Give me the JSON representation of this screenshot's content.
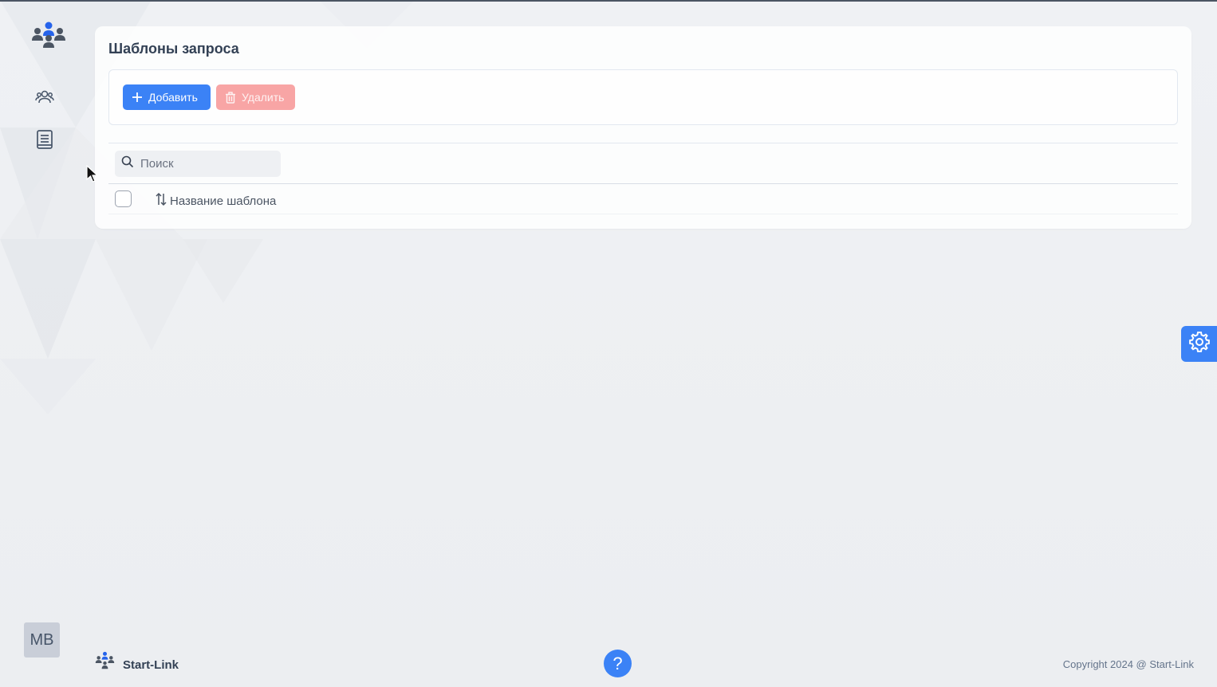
{
  "sidebar": {
    "logo_icon": "team-logo-icon",
    "items": [
      {
        "icon": "users-icon"
      },
      {
        "icon": "document-icon"
      }
    ],
    "avatar_initials": "MB"
  },
  "page": {
    "title": "Шаблоны запроса"
  },
  "toolbar": {
    "add_label": "Добавить",
    "add_icon": "plus-icon",
    "delete_label": "Удалить",
    "delete_icon": "trash-icon"
  },
  "search": {
    "placeholder": "Поиск",
    "value": ""
  },
  "table": {
    "columns": [
      {
        "label": "Название шаблона",
        "sortable": true
      }
    ],
    "rows": []
  },
  "footer": {
    "brand": "Start-Link",
    "copyright": "Copyright 2024 @ Start-Link",
    "help_icon": "question-icon"
  },
  "colors": {
    "primary": "#3b82f6",
    "danger_disabled": "#f8a5a5",
    "background": "#eef0f3"
  }
}
